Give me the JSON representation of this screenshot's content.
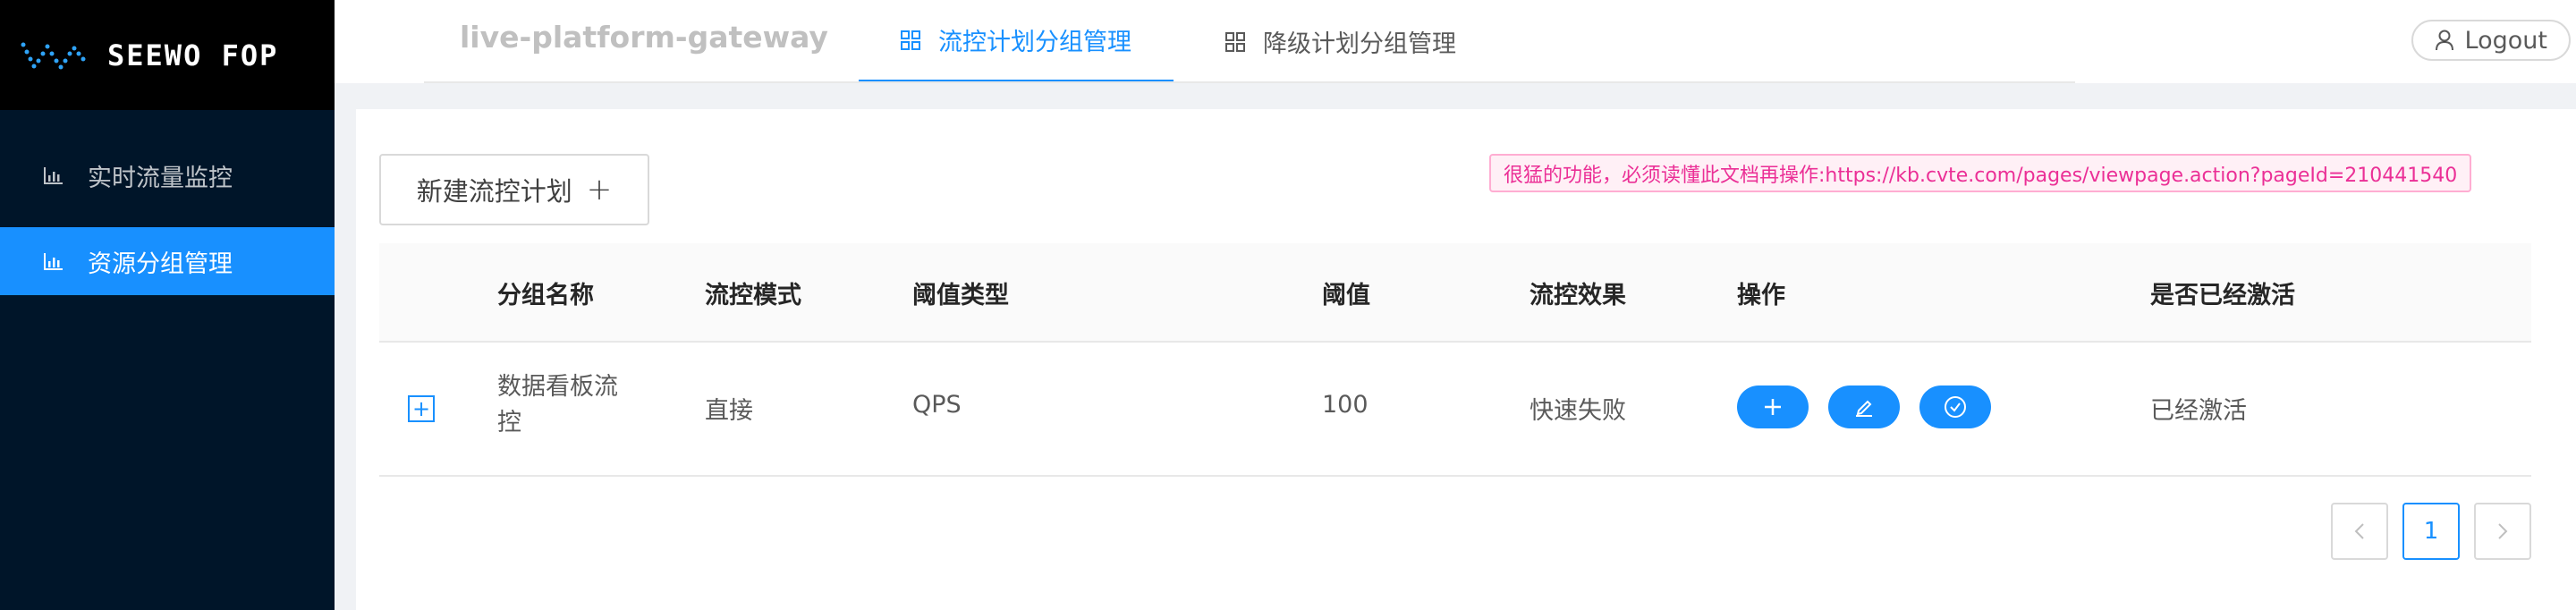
{
  "brand": {
    "logo_text": "SEEWO FOP"
  },
  "sidebar": {
    "items": [
      {
        "label": "实时流量监控",
        "active": false,
        "icon": "bar-chart-icon"
      },
      {
        "label": "资源分组管理",
        "active": true,
        "icon": "bar-chart-icon"
      }
    ]
  },
  "header": {
    "app_name": "live-platform-gateway",
    "tabs": [
      {
        "label": "流控计划分组管理",
        "active": true,
        "icon": "appstore-icon"
      },
      {
        "label": "降级计划分组管理",
        "active": false,
        "icon": "appstore-icon"
      }
    ],
    "logout_label": "Logout"
  },
  "toolbar": {
    "new_button_label": "新建流控计划",
    "notice": "很猛的功能，必须读懂此文档再操作:https://kb.cvte.com/pages/viewpage.action?pageId=210441540"
  },
  "table": {
    "columns": [
      "分组名称",
      "流控模式",
      "阈值类型",
      "阈值",
      "流控效果",
      "操作",
      "是否已经激活"
    ],
    "rows": [
      {
        "group_name": "数据看板流控",
        "mode": "直接",
        "threshold_type": "QPS",
        "threshold": "100",
        "effect": "快速失败",
        "actions": [
          "add-icon",
          "edit-icon",
          "check-circle-icon"
        ],
        "activated": "已经激活"
      }
    ]
  },
  "pagination": {
    "current": "1"
  },
  "colors": {
    "primary": "#1890ff",
    "sidebar_bg": "#001529",
    "notice_text": "#eb2f96"
  }
}
